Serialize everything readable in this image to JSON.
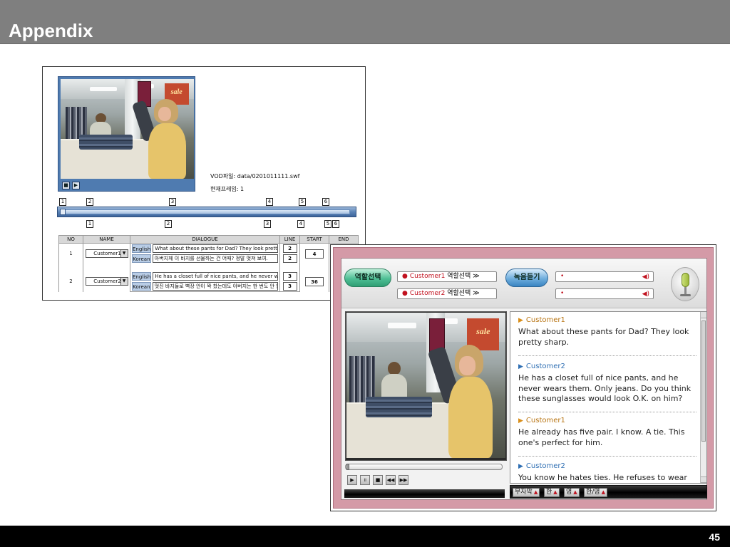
{
  "slide": {
    "title": "Appendix",
    "page_number": "45"
  },
  "authoring": {
    "vod_file": "VOD파일: data/0201011111.swf",
    "current_frame": "현재프레임: 1",
    "video_controls": [
      "■",
      "▶"
    ],
    "top_markers": [
      "1",
      "2",
      "3",
      "4",
      "5",
      "6"
    ],
    "bottom_markers": [
      "1",
      "2",
      "3",
      "4",
      "5",
      "6"
    ],
    "table": {
      "headers": [
        "NO",
        "NAME",
        "DIALOGUE",
        "LINE",
        "START",
        "END"
      ],
      "rows": [
        {
          "no": "1",
          "name": "Customer1",
          "english_label": "English",
          "korean_label": "Korean",
          "english_text": "What about these pants for Dad? They look pretty sharp.",
          "korean_text": "아버지께 이 바지를 선물하는 건 어때? 정말 멋져 보여.",
          "english_line": "2",
          "korean_line": "2",
          "start": "4",
          "end": ""
        },
        {
          "no": "2",
          "name": "Customer2",
          "english_label": "English",
          "korean_label": "Korean",
          "english_text": "He has a closet full of nice pants, and he never wears them.",
          "korean_text": "멋진 바지들로 벽장 안이 꽉 찼는데도 아버지는 한 번도 안 입으셔.",
          "english_line": "3",
          "korean_line": "3",
          "start": "36",
          "end": ""
        }
      ]
    }
  },
  "player": {
    "role_tab": "역할선택",
    "record_tab": "녹음듣기",
    "role_buttons": [
      {
        "customer": "Customer1",
        "label": "역할선택",
        "arrow": "≫"
      },
      {
        "customer": "Customer2",
        "label": "역할선택",
        "arrow": "≫"
      }
    ],
    "record_slots": [
      "•",
      "•"
    ],
    "speaker_icon": "◀)",
    "controls": [
      "▶",
      "॥",
      "■",
      "◀◀",
      "▶▶"
    ],
    "script": [
      {
        "speaker": "Customer1",
        "text": "What about these pants for Dad? They look pretty sharp."
      },
      {
        "speaker": "Customer2",
        "text": "He has a closet full of nice pants, and he never wears them. Only jeans. Do you think these sunglasses would look O.K. on him?"
      },
      {
        "speaker": "Customer1",
        "text": "He already has five pair. I know. A tie. This one's perfect for him."
      },
      {
        "speaker": "Customer2",
        "text": "You know he hates ties. He refuses to wear"
      }
    ],
    "subtitle_tabs": [
      "무자막",
      "한",
      "영",
      "한/영"
    ],
    "video_banner_text": "sale",
    "colors": {
      "frame": "#d49aa7",
      "customer1": "#b87412",
      "customer2": "#2f6fb3",
      "accent_red": "#c1121f"
    }
  }
}
